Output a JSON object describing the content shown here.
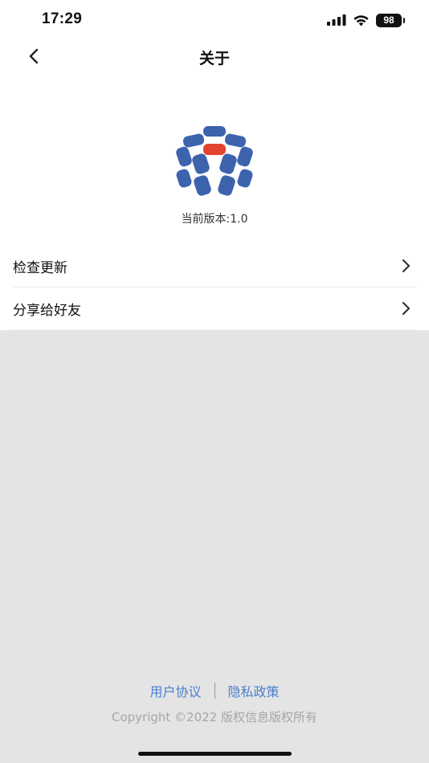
{
  "status_bar": {
    "time": "17:29",
    "battery_level": "98",
    "icons": [
      "signal-icon",
      "wifi-icon",
      "battery-icon"
    ]
  },
  "nav": {
    "title": "关于",
    "back_icon": "chevron-left-icon"
  },
  "app": {
    "logo_icon": "cube-logo-icon",
    "version_text": "当前版本:1.0"
  },
  "menu": {
    "items": [
      {
        "label": "检查更新",
        "icon": "chevron-right-icon"
      },
      {
        "label": "分享给好友",
        "icon": "chevron-right-icon"
      }
    ]
  },
  "footer": {
    "user_agreement": "用户协议",
    "privacy_policy": "隐私政策",
    "copyright": "Copyright ©2022 版权信息版权所有"
  },
  "colors": {
    "logo_blue": "#3d63ad",
    "logo_red": "#e2432f",
    "link_blue": "#4a7fd0",
    "background_gray": "#e4e4e4"
  }
}
